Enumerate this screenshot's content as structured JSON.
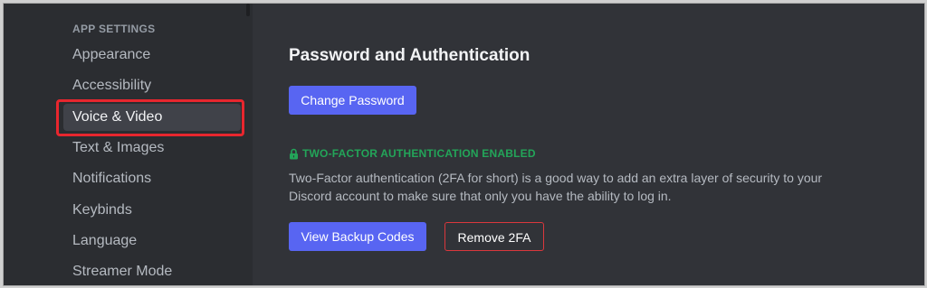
{
  "sidebar": {
    "section_header": "APP SETTINGS",
    "items": [
      {
        "label": "Appearance",
        "selected": false
      },
      {
        "label": "Accessibility",
        "selected": false
      },
      {
        "label": "Voice & Video",
        "selected": true
      },
      {
        "label": "Text & Images",
        "selected": false
      },
      {
        "label": "Notifications",
        "selected": false
      },
      {
        "label": "Keybinds",
        "selected": false
      },
      {
        "label": "Language",
        "selected": false
      },
      {
        "label": "Streamer Mode",
        "selected": false
      }
    ]
  },
  "main": {
    "title": "Password and Authentication",
    "change_password_label": "Change Password",
    "two_factor": {
      "status_icon": "lock-icon",
      "status_text": "TWO-FACTOR AUTHENTICATION ENABLED",
      "description": "Two-Factor authentication (2FA for short) is a good way to add an extra layer of security to your Discord account to make sure that only you have the ability to log in.",
      "view_backup_codes_label": "View Backup Codes",
      "remove_2fa_label": "Remove 2FA"
    }
  },
  "colors": {
    "sidebar_bg": "#2b2d31",
    "content_bg": "#313338",
    "brand": "#5865f2",
    "success": "#23a559",
    "danger": "#da373c",
    "annotation": "#e8262e"
  }
}
